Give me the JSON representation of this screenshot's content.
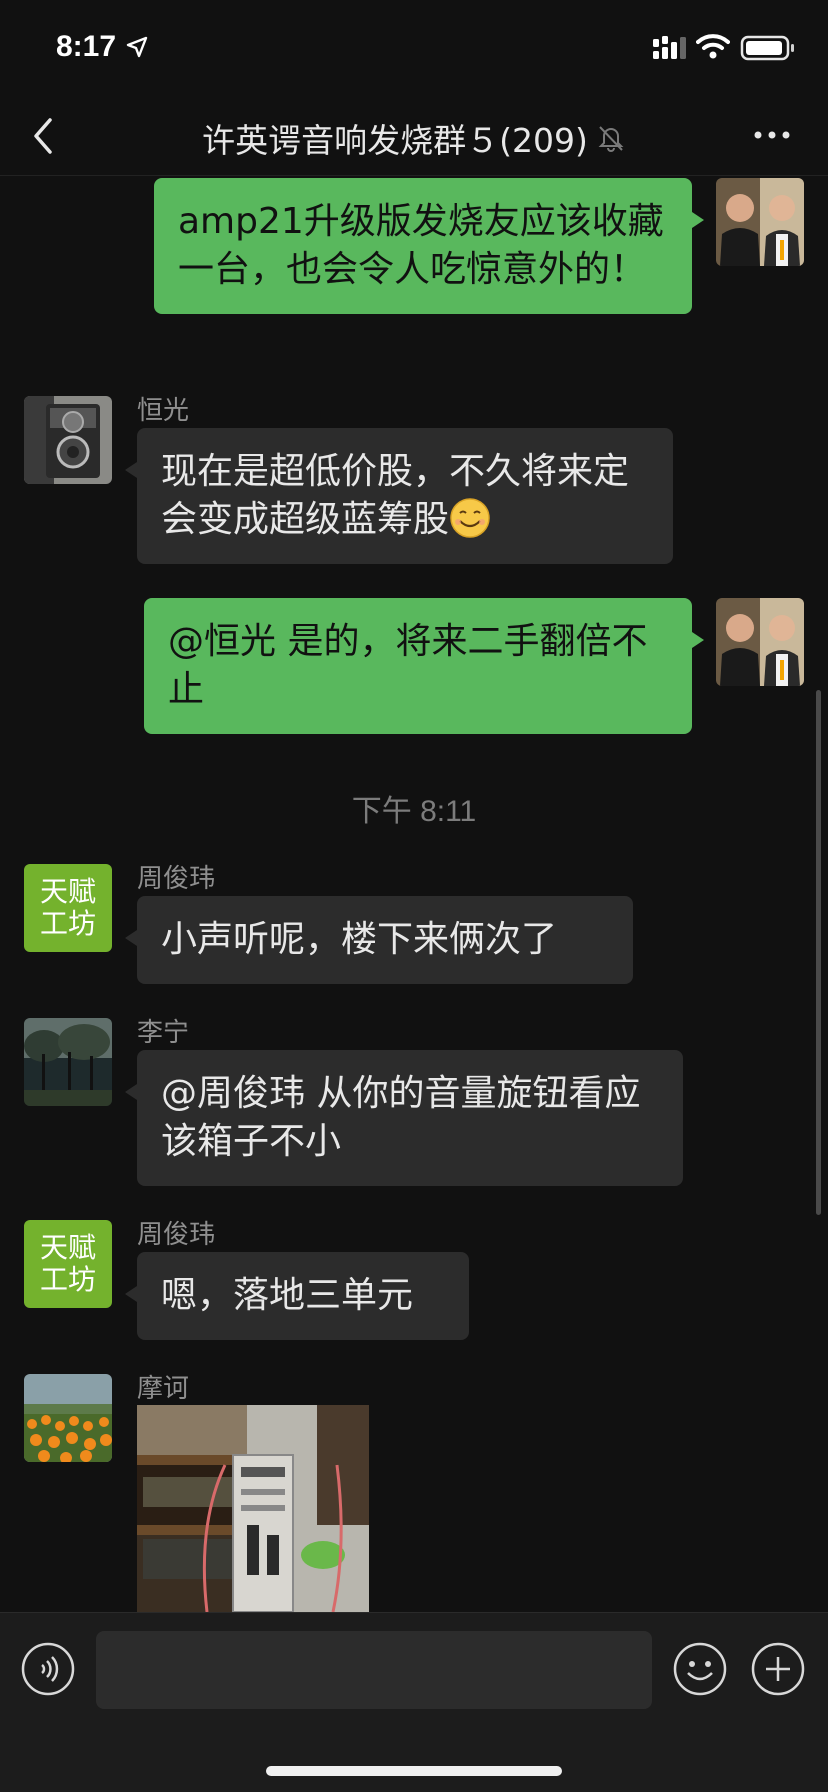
{
  "status": {
    "time": "8:17"
  },
  "nav": {
    "title": "许英谔音响发烧群５(209)"
  },
  "messages": {
    "m1": {
      "text": "amp21升级版发烧友应该收藏一台，也会令人吃惊意外的！"
    },
    "m2": {
      "sender": "恒光",
      "text": "现在是超低价股，不久将来定会变成超级蓝筹股"
    },
    "m3": {
      "text": "@恒光 是的，将来二手翻倍不止"
    },
    "timestamp": "下午 8:11",
    "m4": {
      "sender": "周俊玮",
      "text": "小声听呢，楼下来俩次了"
    },
    "m5": {
      "sender": "李宁",
      "text": "@周俊玮 从你的音量旋钮看应该箱子不小"
    },
    "m6": {
      "sender": "周俊玮",
      "text": "嗯，落地三单元"
    },
    "m7": {
      "sender": "摩诃"
    }
  },
  "avatars": {
    "green_brand_line1": "天赋",
    "green_brand_line2": "工坊"
  },
  "input": {
    "placeholder": ""
  },
  "colors": {
    "mine_bubble": "#59b85d",
    "their_bubble": "#2c2c2c",
    "background": "#111111",
    "brand_green": "#74b22d"
  }
}
